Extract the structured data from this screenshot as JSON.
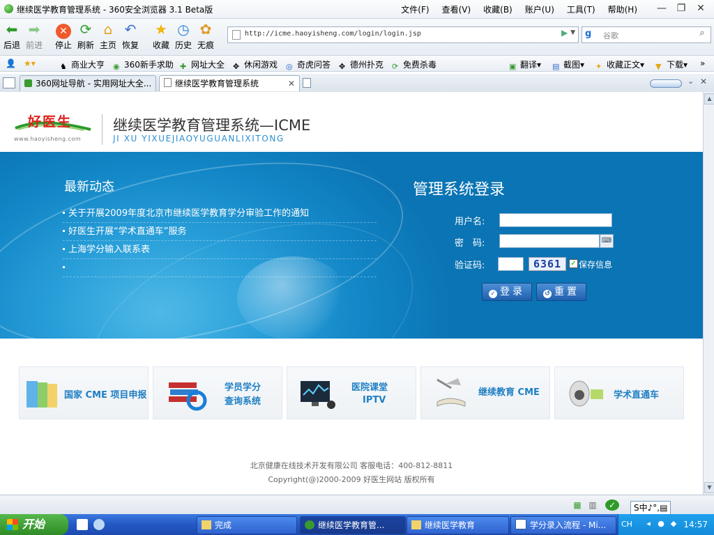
{
  "window": {
    "title": "继续医学教育管理系统 - 360安全浏览器 3.1 Beta版",
    "menu": [
      "文件(F)",
      "查看(V)",
      "收藏(B)",
      "账户(U)",
      "工具(T)",
      "帮助(H)"
    ],
    "controls": {
      "minimize": "—",
      "maximize": "❐",
      "close": "✕"
    }
  },
  "toolbar": {
    "back": "后退",
    "forward": "前进",
    "stop": "停止",
    "refresh": "刷新",
    "home": "主页",
    "restore": "恢复",
    "favorites": "收藏",
    "history": "历史",
    "incognito": "无痕",
    "url": "http://icme.haoyisheng.com/login/login.jsp",
    "search_placeholder": "谷歌"
  },
  "favorites_bar": [
    "商业大亨",
    "360新手求助",
    "网址大全",
    "休闲游戏",
    "奇虎问答",
    "德州扑克",
    "免费杀毒"
  ],
  "favorites_right": [
    "翻译",
    "截图",
    "收藏正文",
    "下载"
  ],
  "tabs": [
    {
      "label": "360网址导航 - 实用网址大全...",
      "active": false
    },
    {
      "label": "继续医学教育管理系统",
      "active": true
    }
  ],
  "site": {
    "logo": "好医生",
    "logo_url": "www.haoyisheng.com",
    "system_title": "继续医学教育管理系统—ICME",
    "system_pinyin": "JI XU YIXUEJIAOYUGUANLIXITONG"
  },
  "news": {
    "title": "最新动态",
    "items": [
      "关于开展2009年度北京市继续医学教育学分审验工作的通知",
      "好医生开展“学术直通车”服务",
      "上海学分输入联系表",
      ""
    ]
  },
  "login": {
    "title": "管理系统登录",
    "username_label": "用户名:",
    "password_label": "密　码:",
    "captcha_label": "验证码:",
    "username_value": "",
    "password_value": "",
    "captcha_value": "",
    "captcha_code": "6361",
    "remember_label": "保存信息",
    "remember_checked": true,
    "login_button": "登录",
    "reset_button": "重置"
  },
  "quick_links": [
    {
      "line1": "国家 CME 项目申报",
      "line2": ""
    },
    {
      "line1": "学员学分",
      "line2": "查询系统"
    },
    {
      "line1": "医院课堂",
      "line2": "IPTV"
    },
    {
      "line1": "继续教育 CME",
      "line2": ""
    },
    {
      "line1": "学术直通车",
      "line2": ""
    }
  ],
  "footer": {
    "line1": "北京健康在线技术开发有限公司 客服电话：400-812-8811",
    "line2": "Copyright(@)2000-2009 好医生网站 版权所有"
  },
  "statusbar": {
    "ime": "S中♪°,▤"
  },
  "taskbar": {
    "start": "开始",
    "tasks": [
      {
        "label": "完成",
        "active": false
      },
      {
        "label": "继续医学教育管...",
        "active": true
      },
      {
        "label": "继续医学教育",
        "active": false
      },
      {
        "label": "学分录入流程 - Mi...",
        "active": false
      }
    ],
    "lang": "CH",
    "clock": "14:57"
  },
  "colors": {
    "banner_blue": "#1286c6",
    "logo_red": "#e0211b",
    "link_blue": "#1f7fc4",
    "taskbar_blue": "#2458c4",
    "start_green": "#3a9a30"
  }
}
